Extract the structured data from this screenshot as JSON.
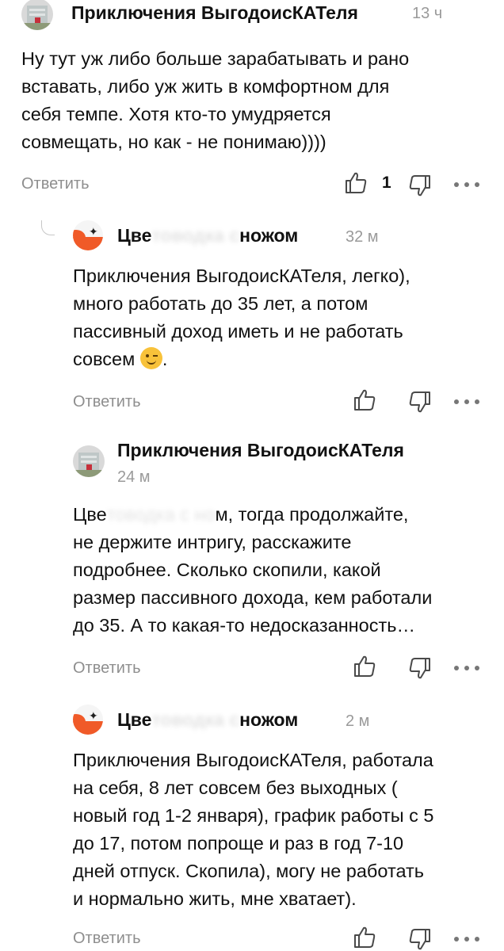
{
  "comments": [
    {
      "author": "Приключения ВыгодоисКАТеля",
      "time": "13 ч",
      "lines": [
        "Ну тут уж либо больше зарабатывать и рано",
        "вставать, либо уж жить в комфортном для",
        "себя темпе. Хотя кто-то умудряется",
        "совмещать, но как - не понимаю))))"
      ],
      "reply": "Ответить",
      "likes": "1"
    },
    {
      "author_visible": "Цве",
      "author_blurred": "товодка с",
      "author_end": "ножом",
      "time": "32 м",
      "lines": [
        "Приключения ВыгодоисКАТеля, легко),",
        "много работать до 35 лет, а потом",
        "пассивный доход иметь и не работать",
        "совсем"
      ],
      "emoji_name": "winking-face",
      "tail": ".",
      "reply": "Ответить"
    },
    {
      "author": "Приключения ВыгодоисКАТеля",
      "time": "24 м",
      "line1_visible": "Цве",
      "line1_blurred": "товодка с но",
      "line1_end": "м, тогда продолжайте,",
      "lines": [
        "не держите интригу, расскажите",
        "подробнее. Сколько скопили, какой",
        "размер пассивного дохода, кем работали",
        "до 35. А то какая-то недосказанность…"
      ],
      "reply": "Ответить"
    },
    {
      "author_visible": "Цве",
      "author_blurred": "товодка с ",
      "author_end": "ножом",
      "time": "2 м",
      "lines": [
        "Приключения ВыгодоисКАТеля, работала",
        "на себя, 8 лет совсем без выходных (",
        "новый год 1-2 января), график работы с 5",
        "до 17, потом попроще и раз в год 7-10",
        "дней отпуск. Скопила), могу не работать",
        "и нормально жить, мне хватает)."
      ],
      "reply": "Ответить"
    }
  ],
  "icons": {
    "like": "thumbs-up-icon",
    "dislike": "thumbs-down-icon",
    "more": "more-dots-icon"
  },
  "colors": {
    "text": "#111111",
    "muted": "#8e8e8e",
    "accent": "#f05a28"
  }
}
